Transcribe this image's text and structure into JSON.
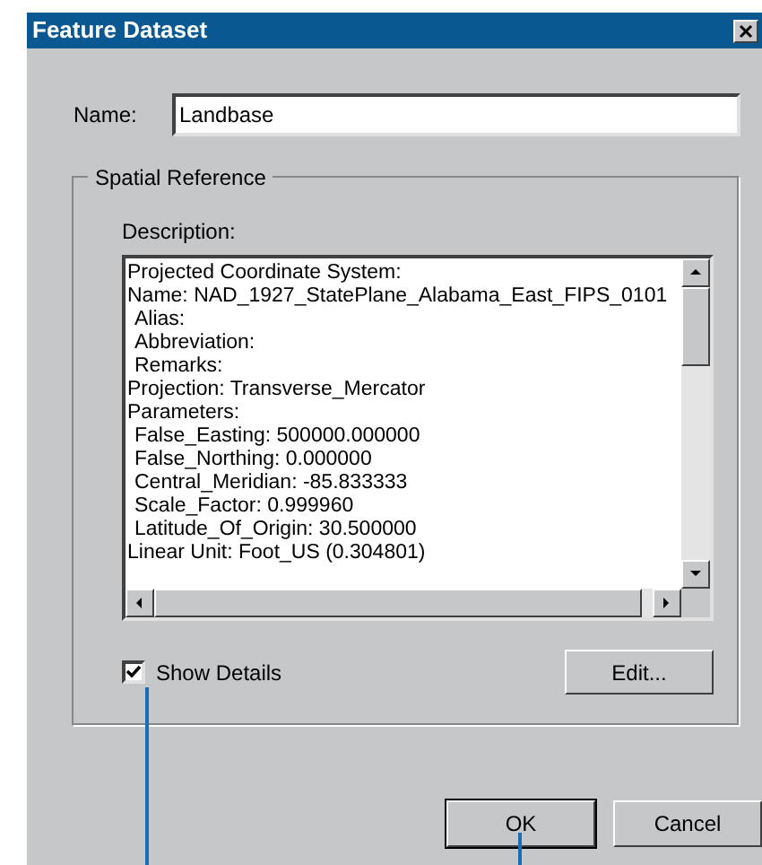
{
  "window": {
    "title": "Feature Dataset"
  },
  "name_field": {
    "label": "Name:",
    "value": "Landbase"
  },
  "spatial_reference": {
    "title": "Spatial Reference",
    "description_label": "Description:",
    "description": [
      {
        "text": "Projected Coordinate System:"
      },
      {
        "text": "Name: NAD_1927_StatePlane_Alabama_East_FIPS_0101",
        "children": [
          {
            "text": "Alias:"
          },
          {
            "text": "Abbreviation:"
          },
          {
            "text": "Remarks:"
          }
        ]
      },
      {
        "text": "Projection: Transverse_Mercator"
      },
      {
        "text": "Parameters:",
        "children": [
          {
            "text": "False_Easting: 500000.000000"
          },
          {
            "text": "False_Northing: 0.000000"
          },
          {
            "text": "Central_Meridian: -85.833333"
          },
          {
            "text": "Scale_Factor: 0.999960"
          },
          {
            "text": "Latitude_Of_Origin: 30.500000"
          }
        ]
      },
      {
        "text": "Linear Unit: Foot_US (0.304801)"
      }
    ],
    "show_details": {
      "label": "Show Details",
      "checked": true
    },
    "edit_button": "Edit..."
  },
  "buttons": [
    {
      "label": "OK",
      "default": true
    },
    {
      "label": "Cancel",
      "default": false
    }
  ]
}
